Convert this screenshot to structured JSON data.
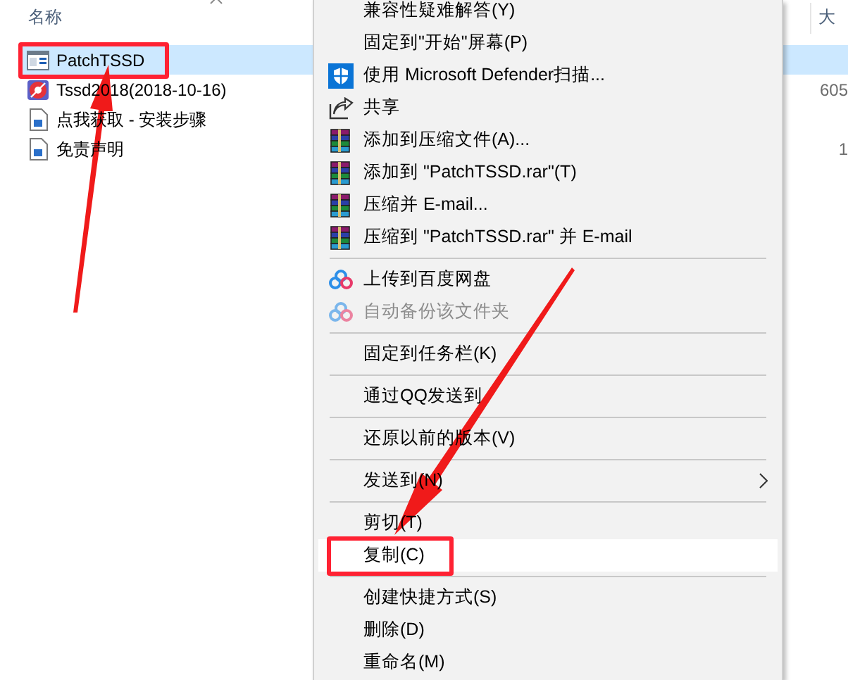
{
  "explorer": {
    "columns": [
      {
        "label": "名称"
      },
      {
        "label": "大"
      }
    ],
    "files": [
      {
        "name": "PatchTSSD",
        "kind": "app",
        "selected": true
      },
      {
        "name": "Tssd2018(2018-10-16)",
        "kind": "installer",
        "size": "605",
        "selected": false
      },
      {
        "name": "点我获取 - 安装步骤",
        "kind": "document",
        "selected": false
      },
      {
        "name": "免责声明",
        "kind": "document",
        "size": "1",
        "selected": false
      }
    ]
  },
  "context_menu": {
    "items": [
      {
        "kind": "text",
        "label": "兼容性疑难解答(Y)",
        "disabled": false,
        "submenu": false,
        "selected": false
      },
      {
        "kind": "text",
        "label": "固定到\"开始\"屏幕(P)",
        "disabled": false,
        "submenu": false,
        "selected": false
      },
      {
        "kind": "shield",
        "label": "使用 Microsoft Defender扫描...",
        "disabled": false,
        "submenu": false,
        "selected": false
      },
      {
        "kind": "share",
        "label": "共享",
        "disabled": false,
        "submenu": false,
        "selected": false
      },
      {
        "kind": "archive",
        "label": "添加到压缩文件(A)...",
        "disabled": false,
        "submenu": false,
        "selected": false
      },
      {
        "kind": "archive",
        "label": "添加到 \"PatchTSSD.rar\"(T)",
        "disabled": false,
        "submenu": false,
        "selected": false
      },
      {
        "kind": "archive",
        "label": "压缩并 E-mail...",
        "disabled": false,
        "submenu": false,
        "selected": false
      },
      {
        "kind": "archive",
        "label": "压缩到 \"PatchTSSD.rar\" 并 E-mail",
        "disabled": false,
        "submenu": false,
        "selected": false
      },
      {
        "kind": "separator"
      },
      {
        "kind": "cloud",
        "label": "上传到百度网盘",
        "disabled": false,
        "submenu": false,
        "selected": false
      },
      {
        "kind": "cloud",
        "label": "自动备份该文件夹",
        "disabled": true,
        "submenu": false,
        "selected": false
      },
      {
        "kind": "separator"
      },
      {
        "kind": "text",
        "label": "固定到任务栏(K)",
        "disabled": false,
        "submenu": false,
        "selected": false
      },
      {
        "kind": "separator"
      },
      {
        "kind": "text",
        "label": "通过QQ发送到",
        "disabled": false,
        "submenu": false,
        "selected": false
      },
      {
        "kind": "separator"
      },
      {
        "kind": "text",
        "label": "还原以前的版本(V)",
        "disabled": false,
        "submenu": false,
        "selected": false
      },
      {
        "kind": "separator"
      },
      {
        "kind": "text",
        "label": "发送到(N)",
        "disabled": false,
        "submenu": true,
        "selected": false
      },
      {
        "kind": "separator"
      },
      {
        "kind": "text",
        "label": "剪切(T)",
        "disabled": false,
        "submenu": false,
        "selected": false
      },
      {
        "kind": "text",
        "label": "复制(C)",
        "disabled": false,
        "submenu": false,
        "selected": true
      },
      {
        "kind": "separator"
      },
      {
        "kind": "text",
        "label": "创建快捷方式(S)",
        "disabled": false,
        "submenu": false,
        "selected": false
      },
      {
        "kind": "text",
        "label": "删除(D)",
        "disabled": false,
        "submenu": false,
        "selected": false
      },
      {
        "kind": "text",
        "label": "重命名(M)",
        "disabled": false,
        "submenu": false,
        "selected": false
      }
    ]
  }
}
